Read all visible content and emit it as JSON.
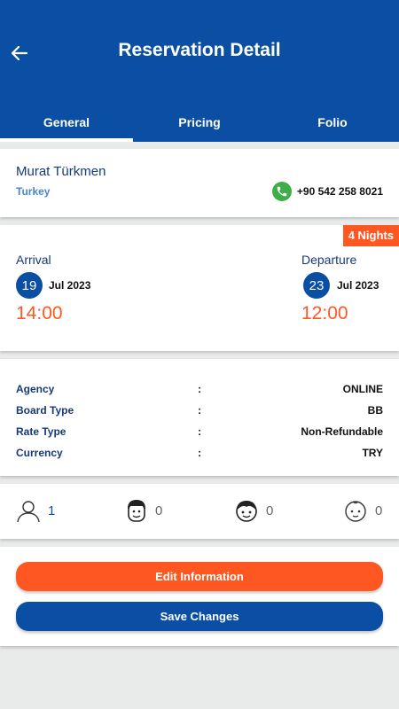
{
  "header": {
    "title": "Reservation Detail",
    "tabs": [
      {
        "label": "General",
        "active": true
      },
      {
        "label": "Pricing",
        "active": false
      },
      {
        "label": "Folio",
        "active": false
      }
    ]
  },
  "guest": {
    "name": "Murat Türkmen",
    "country": "Turkey",
    "phone": "+90 542 258 8021"
  },
  "stay": {
    "nights_badge": "4 Nights",
    "arrival": {
      "label": "Arrival",
      "day": "19",
      "month_year": "Jul 2023",
      "time": "14:00"
    },
    "departure": {
      "label": "Departure",
      "day": "23",
      "month_year": "Jul 2023",
      "time": "12:00"
    }
  },
  "details": [
    {
      "label": "Agency",
      "colon": ":",
      "value": "ONLINE"
    },
    {
      "label": "Board Type",
      "colon": ":",
      "value": "BB"
    },
    {
      "label": "Rate Type",
      "colon": ":",
      "value": "Non-Refundable"
    },
    {
      "label": "Currency",
      "colon": ":",
      "value": "TRY"
    }
  ],
  "occupancy": {
    "adults": "1",
    "teens": "0",
    "children": "0",
    "babies": "0"
  },
  "actions": {
    "edit_label": "Edit Information",
    "save_label": "Save Changes"
  },
  "colors": {
    "primary": "#0a4fa3",
    "accent": "#ff5722",
    "phone_green": "#3fae49",
    "label_blue": "#16397a"
  },
  "icons": {
    "back": "arrow-left-icon",
    "phone": "phone-icon",
    "adult": "adult-person-icon",
    "teen": "teen-face-icon",
    "child": "child-face-icon",
    "baby": "baby-face-icon"
  }
}
